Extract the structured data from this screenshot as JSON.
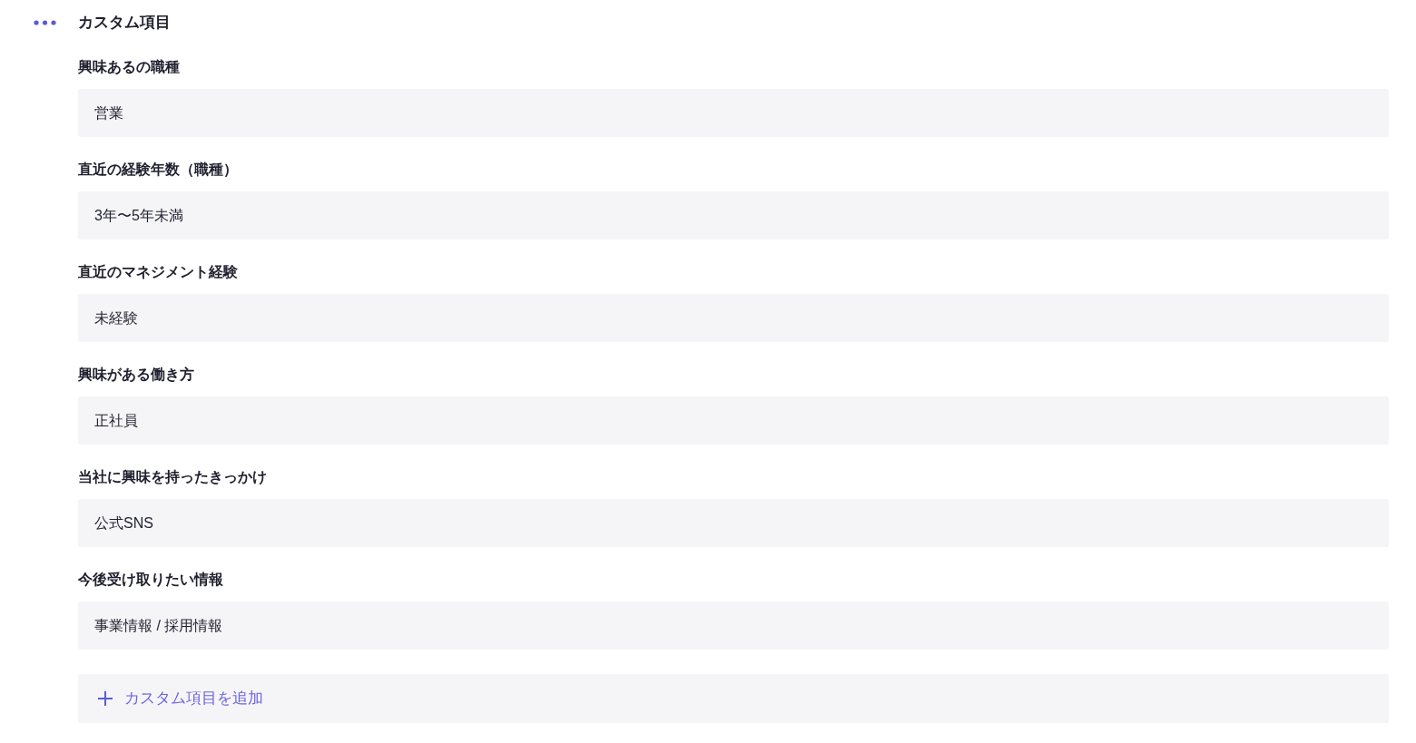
{
  "section": {
    "title": "カスタム項目"
  },
  "fields": [
    {
      "label": "興味あるの職種",
      "value": "営業"
    },
    {
      "label": "直近の経験年数（職種）",
      "value": "3年〜5年未満"
    },
    {
      "label": "直近のマネジメント経験",
      "value": "未経験"
    },
    {
      "label": "興味がある働き方",
      "value": "正社員"
    },
    {
      "label": "当社に興味を持ったきっかけ",
      "value": "公式SNS"
    },
    {
      "label": "今後受け取りたい情報",
      "value": "事業情報 / 採用情報"
    }
  ],
  "add_button": {
    "label": "カスタム項目を追加"
  }
}
